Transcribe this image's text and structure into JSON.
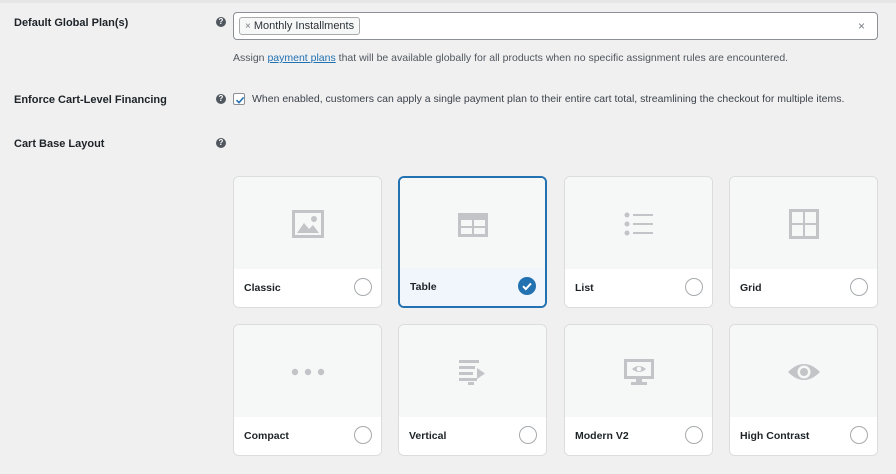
{
  "rows": {
    "global_plans": {
      "label": "Default Global Plan(s)",
      "help": "?",
      "selected_token": "Monthly Installments",
      "token_remove": "×",
      "clear": "×",
      "desc_before": "Assign ",
      "desc_link": "payment plans",
      "desc_after": " that will be available globally for all products when no specific assignment rules are encountered."
    },
    "cart_financing": {
      "label": "Enforce Cart-Level Financing",
      "help": "?",
      "checked": true,
      "text": "When enabled, customers can apply a single payment plan to their entire cart total, streamlining the checkout for multiple items."
    },
    "cart_layout": {
      "label": "Cart Base Layout",
      "help": "?"
    }
  },
  "layouts": [
    {
      "label": "Classic",
      "icon": "image-icon",
      "selected": false
    },
    {
      "label": "Table",
      "icon": "table-icon",
      "selected": true
    },
    {
      "label": "List",
      "icon": "list-icon",
      "selected": false
    },
    {
      "label": "Grid",
      "icon": "grid-icon",
      "selected": false
    },
    {
      "label": "Compact",
      "icon": "ellipsis-icon",
      "selected": false
    },
    {
      "label": "Vertical",
      "icon": "align-right-arrow-icon",
      "selected": false
    },
    {
      "label": "Modern V2",
      "icon": "monitor-icon",
      "selected": false
    },
    {
      "label": "High Contrast",
      "icon": "eye-icon",
      "selected": false
    }
  ],
  "colors": {
    "accent": "#2271b1",
    "icon_gray": "#c3c4c7",
    "background": "#f0f0f1"
  }
}
